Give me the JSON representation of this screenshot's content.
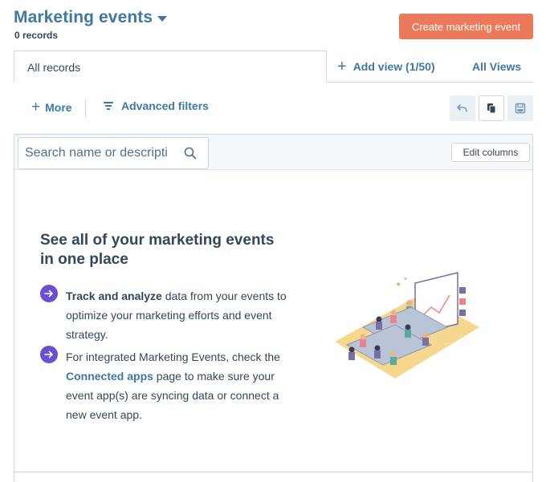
{
  "header": {
    "title": "Marketing events",
    "record_count": "0 records",
    "create_button": "Create marketing event"
  },
  "tabs": {
    "active": "All records",
    "add_view": "Add view (1/50)",
    "all_views": "All Views"
  },
  "toolbar": {
    "more": "More",
    "advanced_filters": "Advanced filters",
    "icons": [
      "undo-icon",
      "clone-icon",
      "save-icon"
    ]
  },
  "table": {
    "search_placeholder": "Search name or descripti",
    "edit_columns": "Edit columns"
  },
  "empty_state": {
    "title": "See all of your marketing events in one place",
    "bullet1_bold": "Track and analyze",
    "bullet1_rest": " data from your events to optimize your marketing efforts and event strategy.",
    "bullet2_pre": "For integrated Marketing Events, check the ",
    "bullet2_link": "Connected apps",
    "bullet2_post": " page to make sure your event app(s) are syncing data or connect a new event app.",
    "illustration": "conference-room-illustration"
  },
  "colors": {
    "link": "#3f79a3",
    "primary_button": "#ec7a5a",
    "bullet_icon": "#6a4fcf",
    "border": "#cbd6e2",
    "text": "#33475b"
  }
}
